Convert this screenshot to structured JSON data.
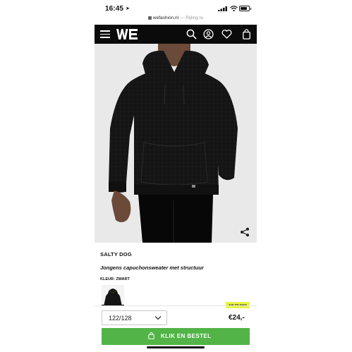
{
  "status_bar": {
    "time": "16:45",
    "location_arrow": "➤"
  },
  "browser": {
    "domain": "wefashion.nl",
    "note": "— Rijling tu",
    "lock_icon": "lock-icon"
  },
  "header": {
    "logo": "WE",
    "icons": [
      "menu-icon",
      "search-icon",
      "account-icon",
      "heart-icon",
      "bag-icon"
    ],
    "background": "#0b0b0b"
  },
  "product": {
    "brand": "SALTY DOG",
    "title": "Jongens capuchonsweater met structuur",
    "color_label": "KLEUR:",
    "color_value": "ZWART",
    "badge": "SALTY DOG",
    "badge_color": "#e9f542"
  },
  "purchase": {
    "size": "122/128",
    "price": "€24,-",
    "button_label": "KLIK EN BESTEL",
    "button_color": "#52b447"
  }
}
